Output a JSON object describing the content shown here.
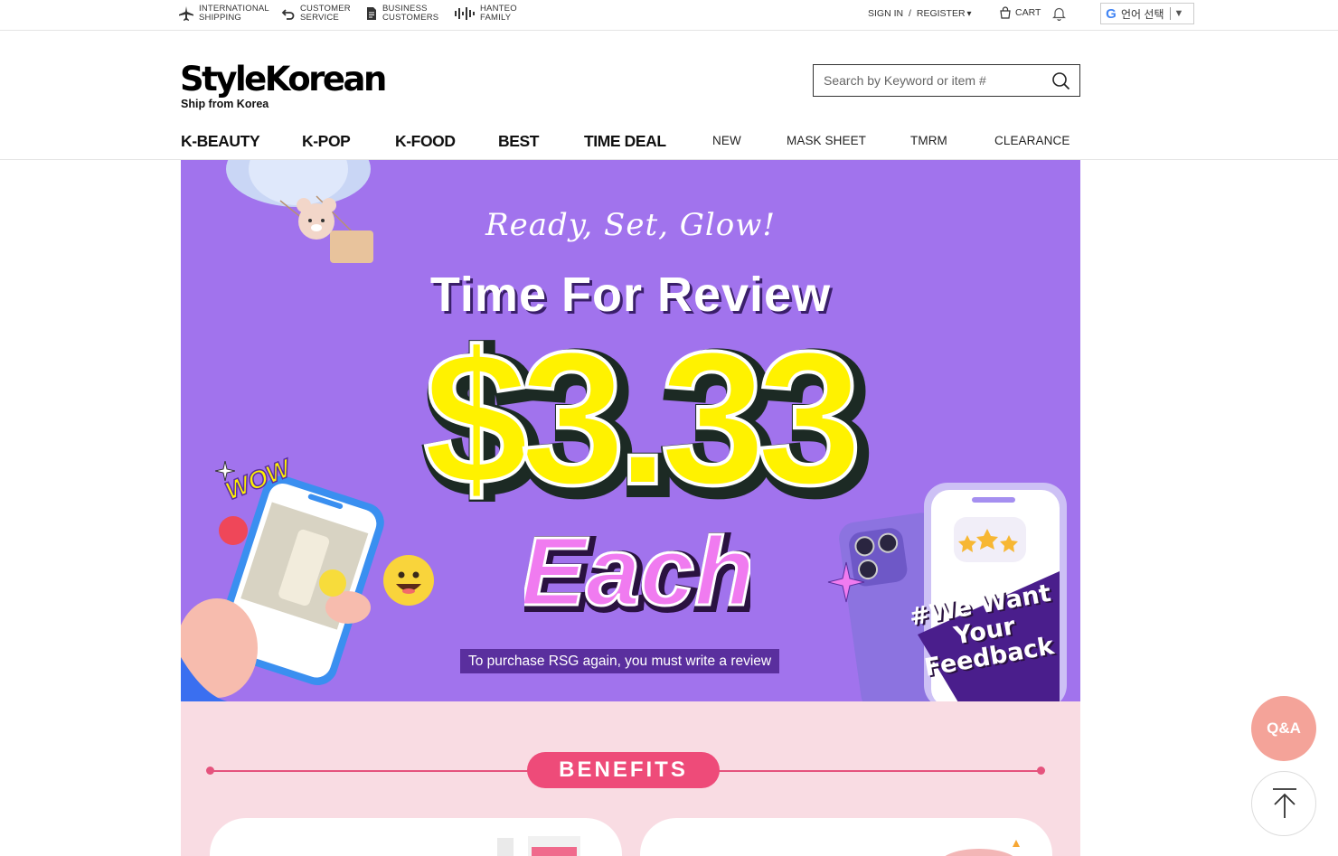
{
  "utility": {
    "items": [
      {
        "label": "INTERNATIONAL SHIPPING",
        "icon": "airplane-icon"
      },
      {
        "label": "CUSTOMER SERVICE",
        "icon": "return-arrow-icon"
      },
      {
        "label": "BUSINESS CUSTOMERS",
        "icon": "document-icon"
      },
      {
        "label": "HANTEO FAMILY",
        "icon": "waveform-icon"
      }
    ],
    "sign_in": "SIGN IN",
    "divider": "/",
    "register": "REGISTER",
    "register_caret": "▾",
    "cart": "CART",
    "bell_icon": "bell-icon",
    "language": {
      "g": "G",
      "label": "언어 선택",
      "arrow": "▼"
    }
  },
  "header": {
    "logo": "StyleKorean",
    "tagline": "Ship from Korea",
    "search_placeholder": "Search by Keyword or item #",
    "search_icon": "search-icon"
  },
  "nav": {
    "items": [
      {
        "label": "K-BEAUTY"
      },
      {
        "label": "K-POP"
      },
      {
        "label": "K-FOOD"
      },
      {
        "label": "BEST"
      },
      {
        "label": "TIME DEAL"
      },
      {
        "label": "NEW"
      },
      {
        "label": "MASK SHEET"
      },
      {
        "label": "TMRM"
      },
      {
        "label": "CLEARANCE"
      }
    ]
  },
  "banner": {
    "script": "Ready, Set, Glow!",
    "title": "Time For Review",
    "price": "$3.33",
    "each": "Each",
    "wow": "WOW",
    "feedback": [
      "#We Want",
      "Your",
      "Feedback"
    ],
    "caption": "To purchase RSG again, you must write a review",
    "colors": {
      "bg": "#a173ed",
      "price": "#fff200",
      "each": "#f07bf0",
      "caption_bg": "#5a2f9e"
    }
  },
  "benefits": {
    "label": "BENEFITS",
    "color": "#ee4b79",
    "bg": "#f9dce3"
  },
  "floating": {
    "qa": "Q&A",
    "top_icon": "arrow-up-icon"
  }
}
